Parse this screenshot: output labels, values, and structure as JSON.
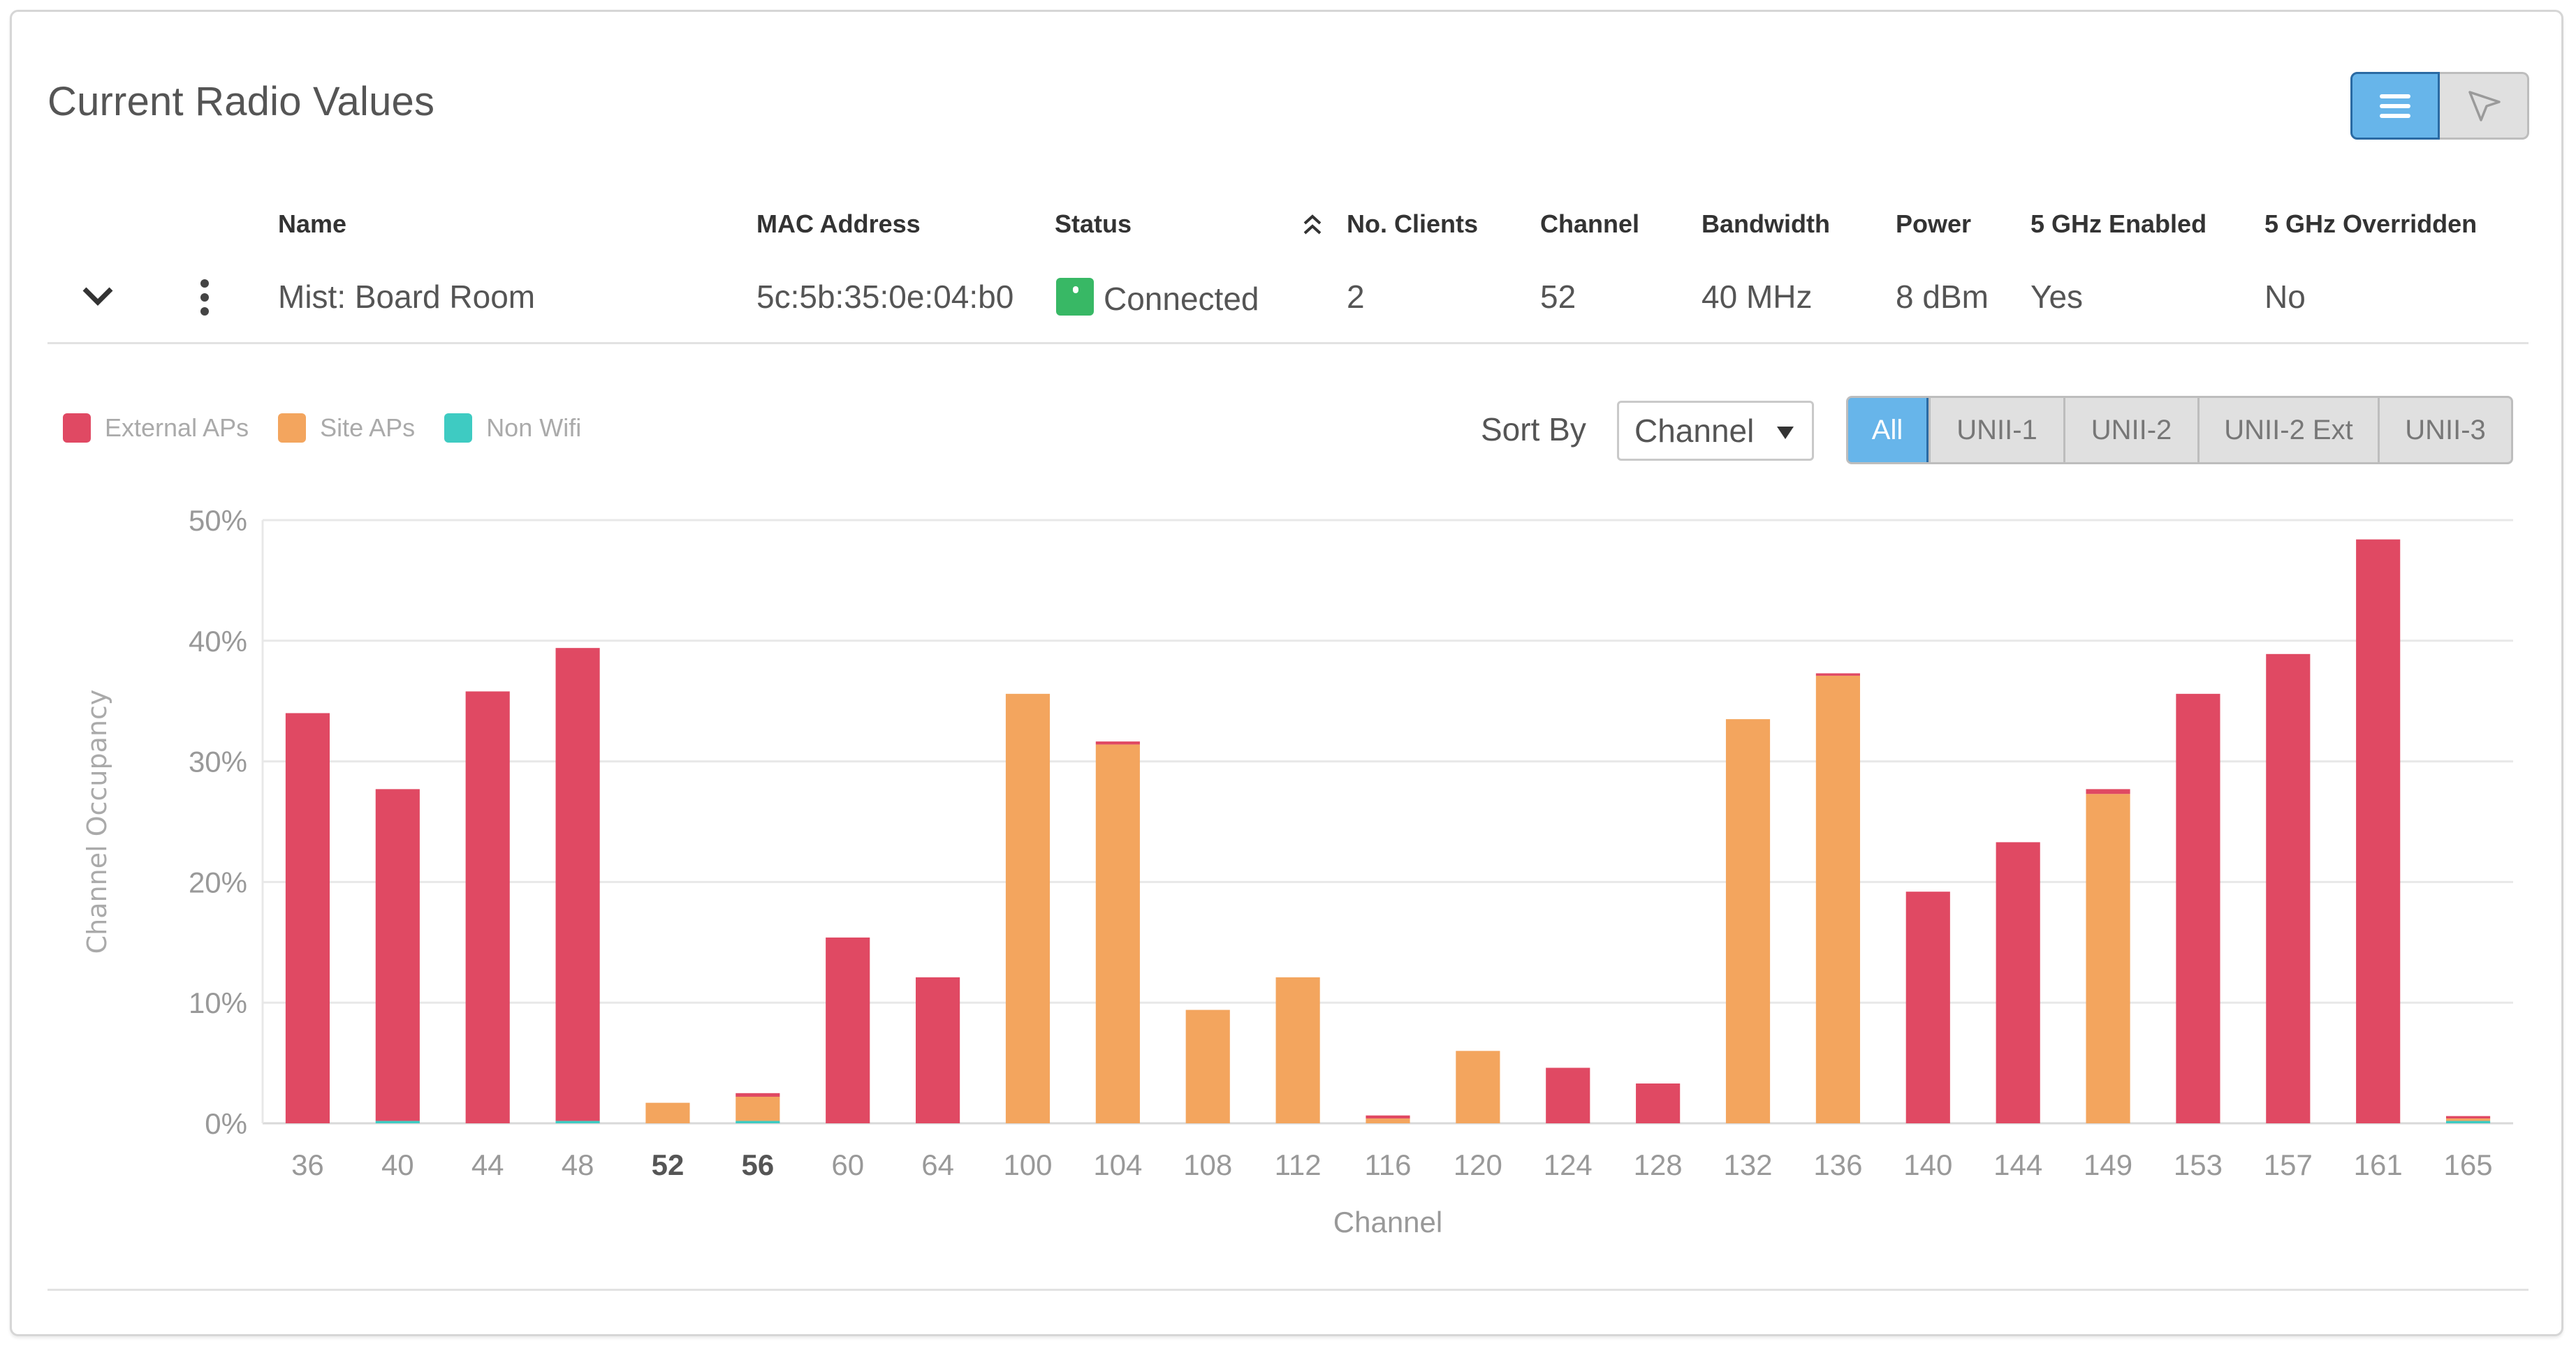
{
  "header": {
    "title": "Current Radio Values",
    "view_toggle": [
      {
        "name": "list-view",
        "icon": "list-icon",
        "active": true
      },
      {
        "name": "map-view",
        "icon": "cursor-arrow-icon",
        "active": false
      }
    ]
  },
  "table": {
    "columns": [
      "Name",
      "MAC Address",
      "Status",
      "No. Clients",
      "Channel",
      "Bandwidth",
      "Power",
      "5 GHz Enabled",
      "5 GHz Overridden"
    ],
    "sort_column": "No. Clients",
    "sort_icon": "double-chevron-up-icon",
    "rows": [
      {
        "name": "Mist: Board Room",
        "mac": "5c:5b:35:0e:04:b0",
        "status": "Connected",
        "status_color": "#38b865",
        "clients": "2",
        "channel": "52",
        "bandwidth": "40 MHz",
        "power": "8 dBm",
        "enabled_5ghz": "Yes",
        "overridden_5ghz": "No"
      }
    ]
  },
  "controls": {
    "sort_label": "Sort By",
    "sort_value": "Channel",
    "band_filters": [
      "All",
      "UNII-1",
      "UNII-2",
      "UNII-2 Ext",
      "UNII-3"
    ],
    "active_band_filter": "All"
  },
  "colors": {
    "external": "#e04963",
    "site": "#f3a55e",
    "nonwifi": "#3ecbc2",
    "accent": "#67b5ea",
    "grid": "#e8e8e8"
  },
  "chart_data": {
    "type": "bar",
    "stacked": true,
    "title": "",
    "xlabel": "Channel",
    "ylabel": "Channel Occupancy",
    "ylim": [
      0,
      50
    ],
    "yticks": [
      "0%",
      "10%",
      "20%",
      "30%",
      "40%",
      "50%"
    ],
    "grid": true,
    "legend_position": "top-left",
    "highlighted_categories": [
      "52",
      "56"
    ],
    "categories": [
      "36",
      "40",
      "44",
      "48",
      "52",
      "56",
      "60",
      "64",
      "100",
      "104",
      "108",
      "112",
      "116",
      "120",
      "124",
      "128",
      "132",
      "136",
      "140",
      "144",
      "149",
      "153",
      "157",
      "161",
      "165"
    ],
    "series": [
      {
        "name": "Non Wifi",
        "key": "nonwifi",
        "values": [
          0,
          0.2,
          0,
          0.2,
          0,
          0.2,
          0,
          0,
          0,
          0,
          0,
          0,
          0,
          0,
          0,
          0,
          0,
          0,
          0,
          0,
          0,
          0,
          0,
          0,
          0.2
        ]
      },
      {
        "name": "Site APs",
        "key": "site",
        "values": [
          0,
          0,
          0,
          0,
          1.7,
          2.0,
          0,
          0,
          35.6,
          31.4,
          9.4,
          12.1,
          0.4,
          6.0,
          0,
          0,
          33.5,
          37.1,
          0,
          0,
          27.3,
          0,
          0,
          0,
          0.2
        ]
      },
      {
        "name": "External APs",
        "key": "external",
        "values": [
          34.0,
          27.5,
          35.8,
          39.2,
          0,
          0.3,
          15.4,
          12.1,
          0,
          0.25,
          0,
          0,
          0.25,
          0,
          4.6,
          3.3,
          0,
          0.2,
          19.2,
          23.3,
          0.4,
          35.6,
          38.9,
          48.4,
          0.2
        ]
      }
    ],
    "legend": [
      "External APs",
      "Site APs",
      "Non Wifi"
    ]
  }
}
